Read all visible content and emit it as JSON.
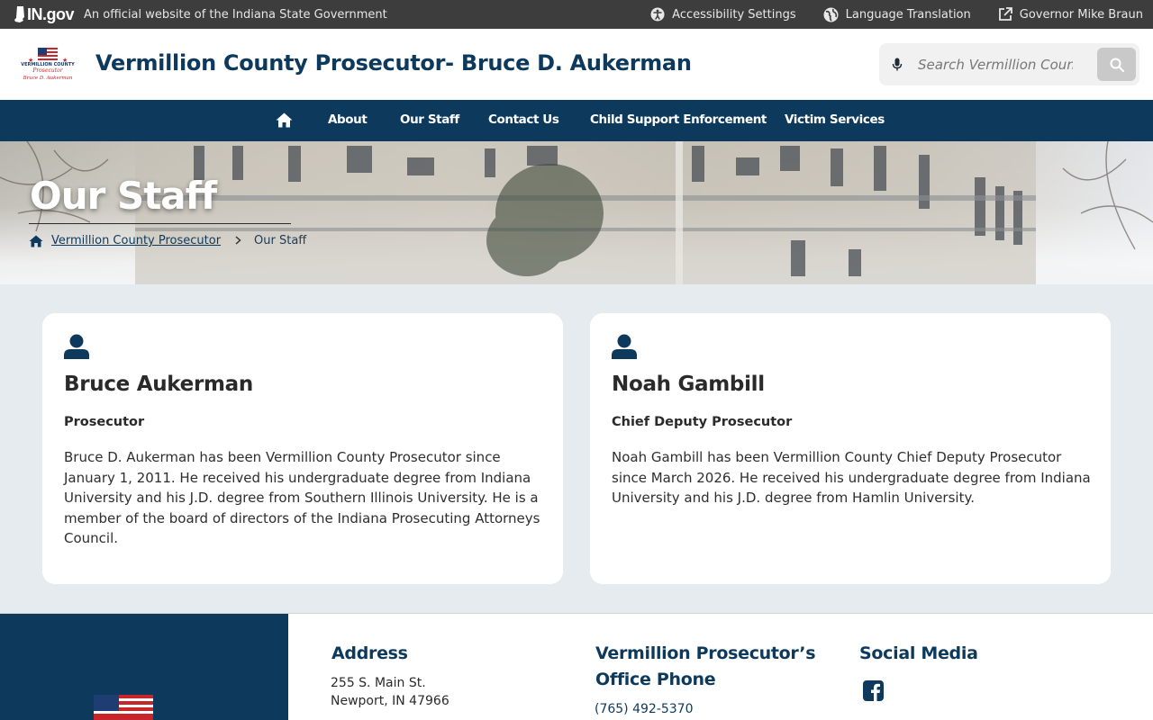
{
  "topbar": {
    "brand": "IN.gov",
    "official_text": "An official website of the Indiana State Government",
    "links": [
      {
        "label": "Accessibility Settings",
        "icon": "accessibility-icon"
      },
      {
        "label": "Language Translation",
        "icon": "globe-icon"
      },
      {
        "label": "Governor Mike Braun",
        "icon": "external-link-icon"
      }
    ]
  },
  "header": {
    "title": "Vermillion County Prosecutor- Bruce D. Aukerman",
    "search_placeholder": "Search Vermillion County Prosecutor"
  },
  "nav": {
    "items": [
      "About",
      "Our Staff",
      "Contact Us",
      "Child Support Enforcement",
      "Victim Services"
    ]
  },
  "hero": {
    "title": "Our Staff",
    "breadcrumb_home": "Vermillion County Prosecutor",
    "breadcrumb_current": "Our Staff"
  },
  "staff": [
    {
      "name": "Bruce Aukerman",
      "role": "Prosecutor",
      "bio": "Bruce D. Aukerman has been Vermillion County Prosecutor since January 1, 2011. He received his undergraduate degree from Indiana University and his J.D. degree from Southern Illinois University. He is a member of the board of directors of the Indiana Prosecuting Attorneys Council."
    },
    {
      "name": "Noah Gambill",
      "role": "Chief Deputy Prosecutor",
      "bio": "Noah Gambill has been Vermillion County Chief Deputy Prosecutor since March 2026. He received his undergraduate degree from Indiana University and his J.D. degree from Hamlin University."
    }
  ],
  "footer": {
    "address_heading": "Address",
    "address_line1": "255 S. Main St.",
    "address_line2": "Newport, IN 47966",
    "phone_heading": "Vermillion Prosecutor’s Office Phone",
    "phone": "(765) 492-5370",
    "social_heading": "Social Media",
    "social_icon": "facebook-icon"
  },
  "colors": {
    "brand_navy": "#0d3a5c",
    "topbar": "#3d3d3d",
    "page_bg": "#e6ebef"
  }
}
